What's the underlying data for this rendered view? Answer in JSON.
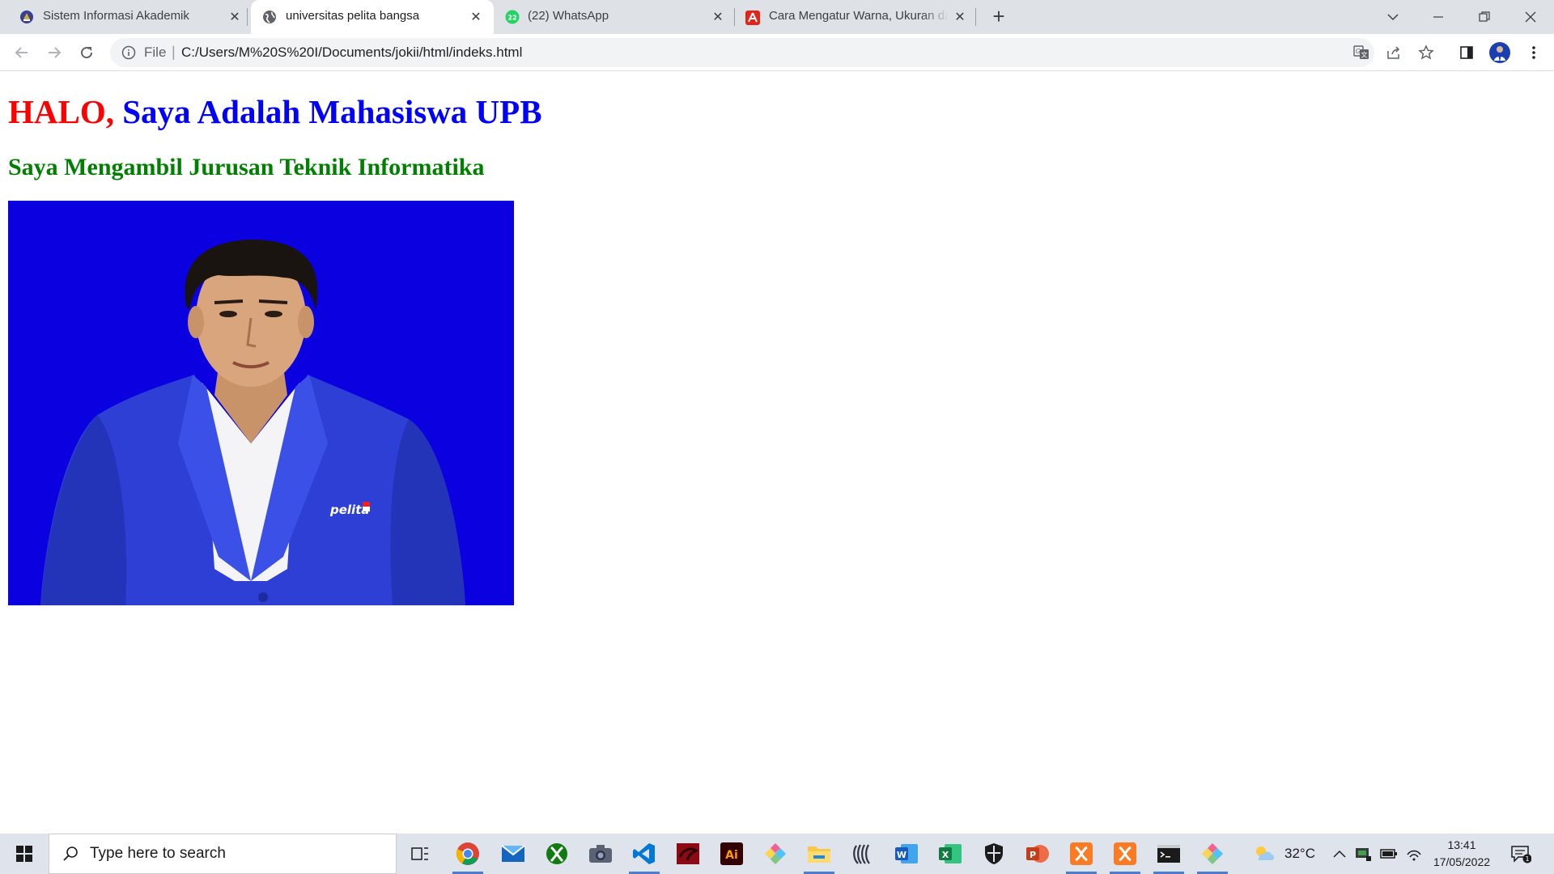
{
  "browser": {
    "tabs": [
      {
        "title": "Sistem Informasi Akademik",
        "favicon": "university-seal-icon",
        "active": false
      },
      {
        "title": "universitas pelita bangsa",
        "favicon": "globe-icon",
        "active": true
      },
      {
        "title": "(22) WhatsApp",
        "favicon": "whatsapp-icon",
        "badge": "22",
        "active": false
      },
      {
        "title": "Cara Mengatur Warna, Ukuran dan",
        "favicon": "adobe-acrobat-icon",
        "active": false
      }
    ],
    "omnibox": {
      "scheme_label": "File",
      "url": "C:/Users/M%20S%20I/Documents/jokii/html/indeks.html"
    }
  },
  "page": {
    "heading_red": "HALO,",
    "heading_blue": " Saya Adalah Mahasiswa UPB",
    "subheading": "Saya Mengambil Jurusan Teknik Informatika",
    "photo_caption_logo": "pelita",
    "colors": {
      "red": "#ff0000",
      "blue": "#0000ff",
      "green": "#008000",
      "photo_bg": "#0a00e0"
    }
  },
  "taskbar": {
    "search_placeholder": "Type here to search",
    "weather": "32°C",
    "time": "13:41",
    "date": "17/05/2022",
    "notification_count": "1"
  }
}
